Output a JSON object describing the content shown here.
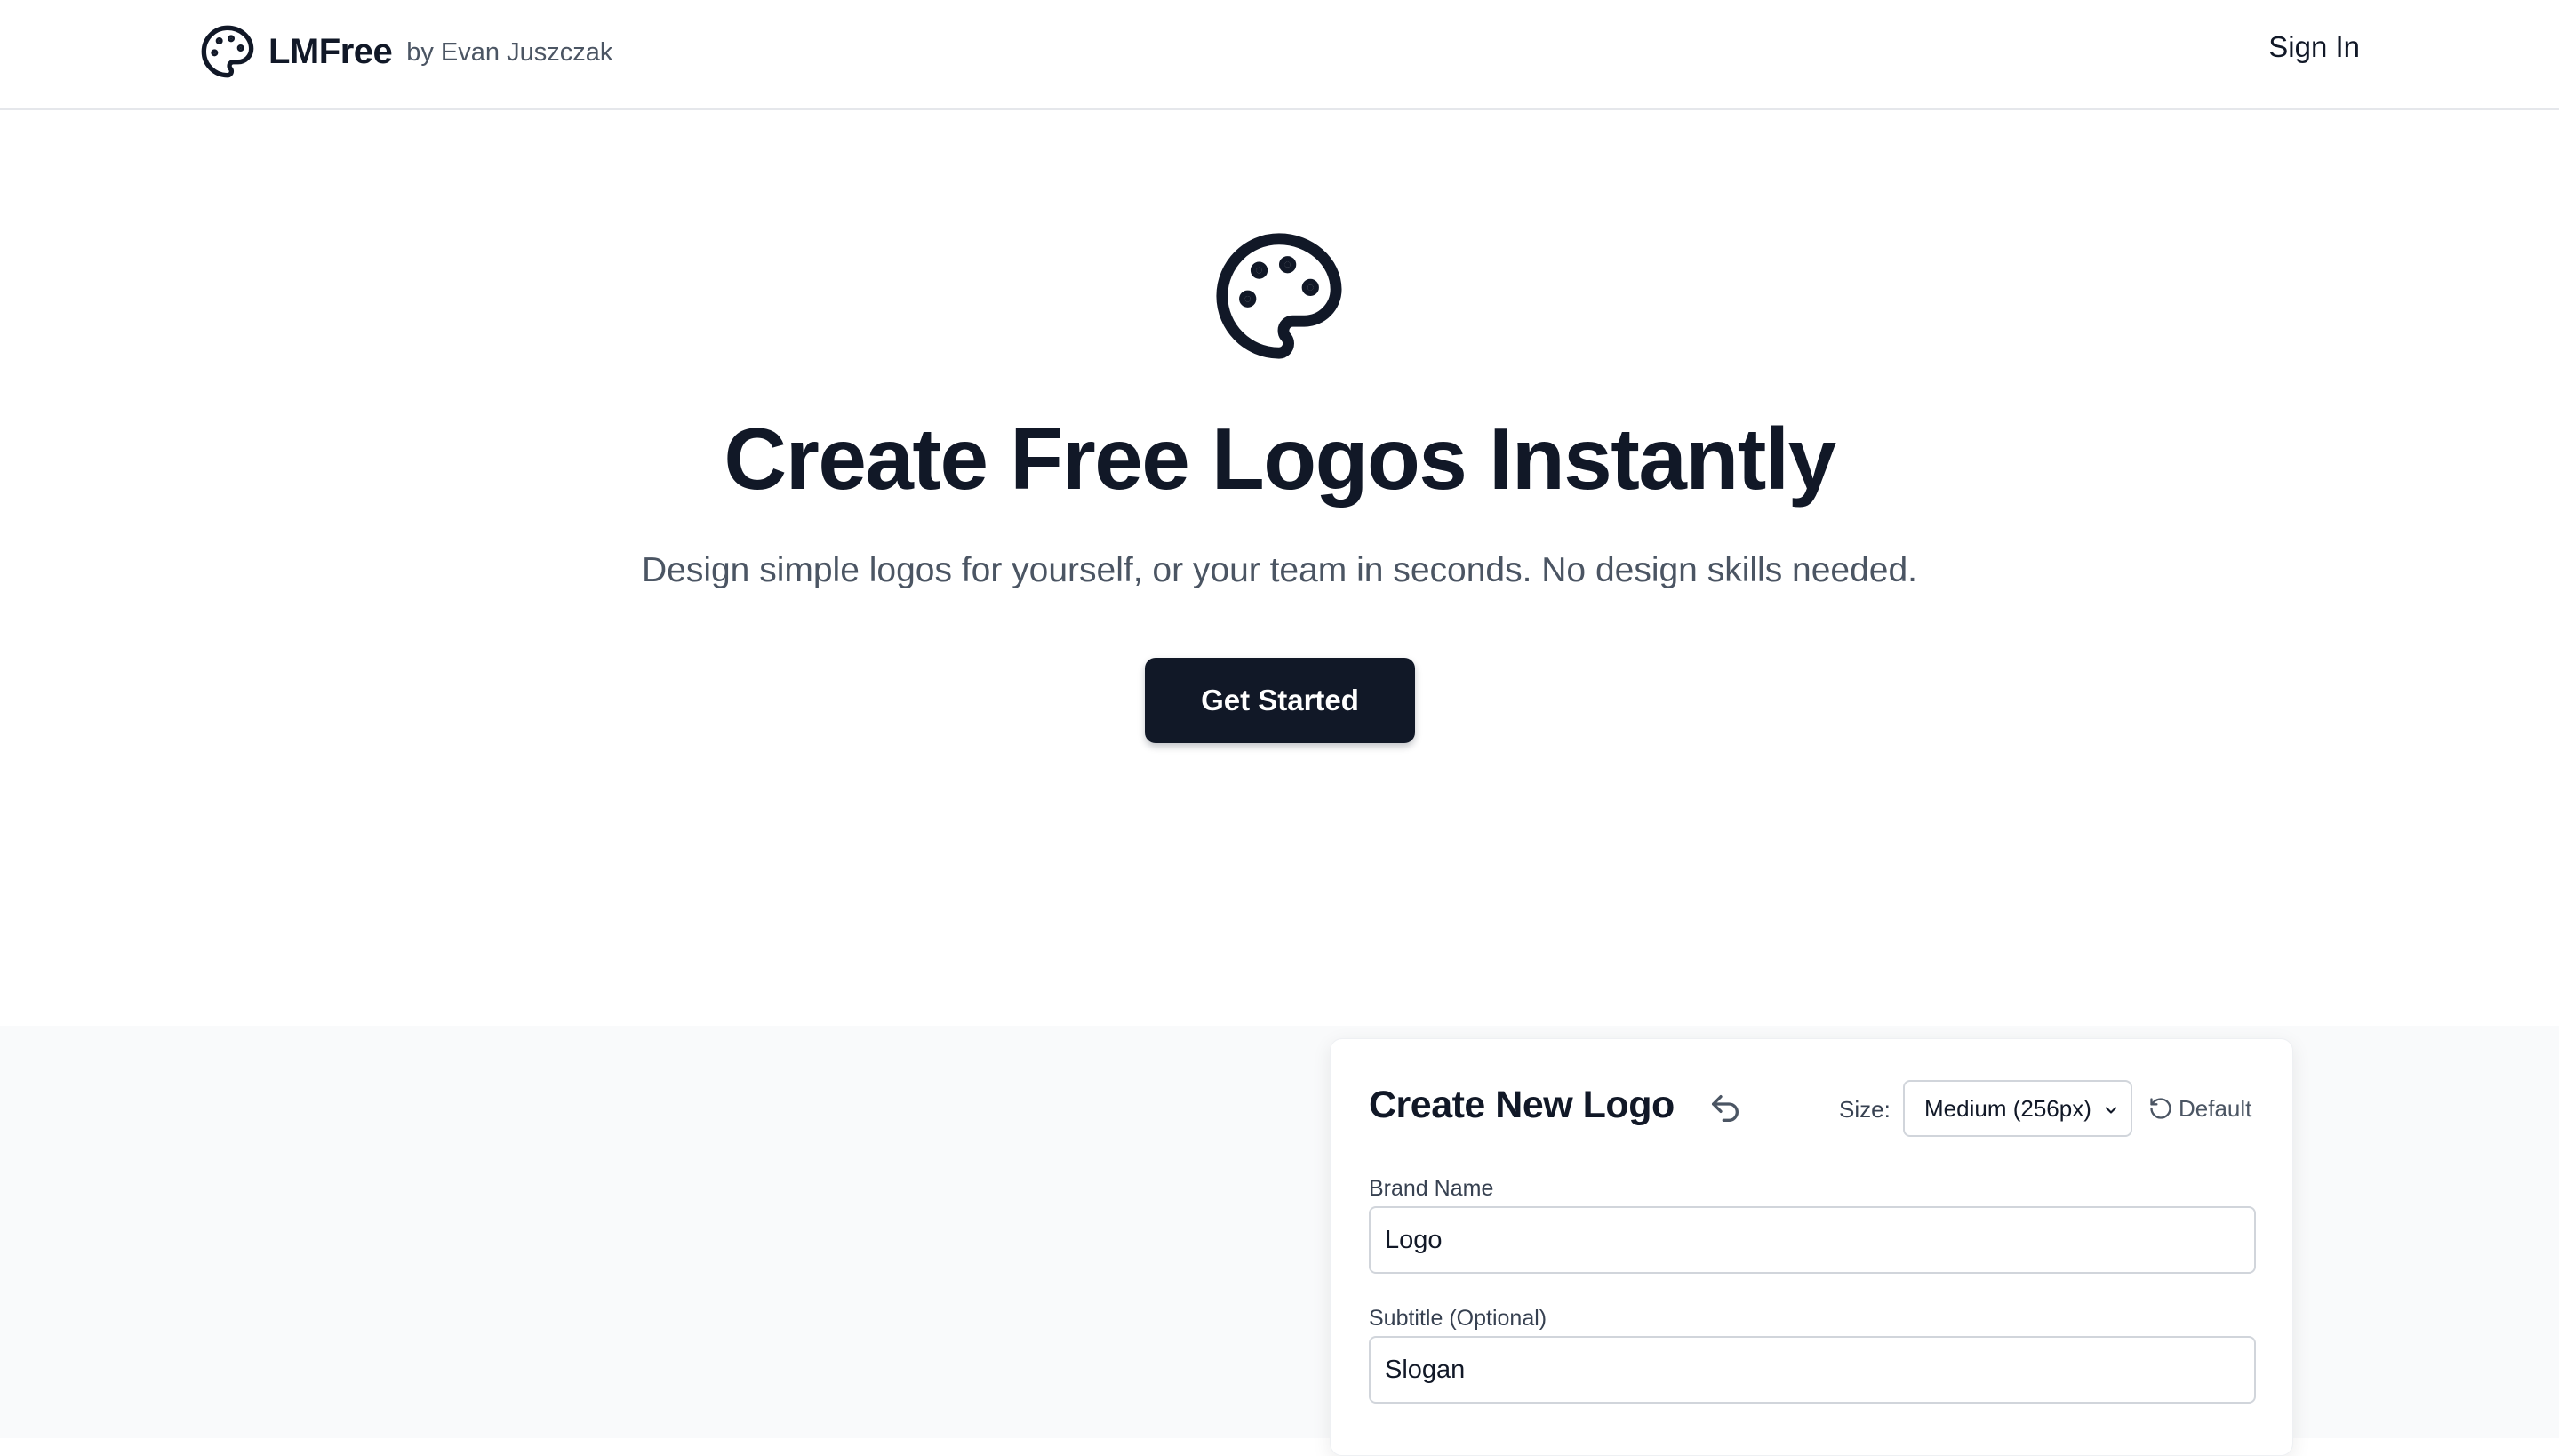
{
  "header": {
    "brand_name": "LMFree",
    "brand_by": "by Evan Juszczak",
    "brand_icon": "palette-icon",
    "signin_label": "Sign In"
  },
  "hero": {
    "icon": "palette-icon",
    "title": "Create Free Logos Instantly",
    "subtitle": "Design simple logos for yourself, or your team in seconds. No design skills needed.",
    "cta_label": "Get Started"
  },
  "editor": {
    "title": "Create New Logo",
    "undo_icon": "undo-icon",
    "size_label": "Size:",
    "size_value": "Medium (256px)",
    "default_label": "Default",
    "default_icon": "reset-icon",
    "brand_name_label": "Brand Name",
    "brand_name_value": "Logo",
    "subtitle_label": "Subtitle (Optional)",
    "subtitle_value": "Slogan"
  },
  "colors": {
    "primary": "#111827",
    "muted_text": "#4b5563",
    "section_bg": "#f9fafb",
    "border": "#d1d5db"
  }
}
